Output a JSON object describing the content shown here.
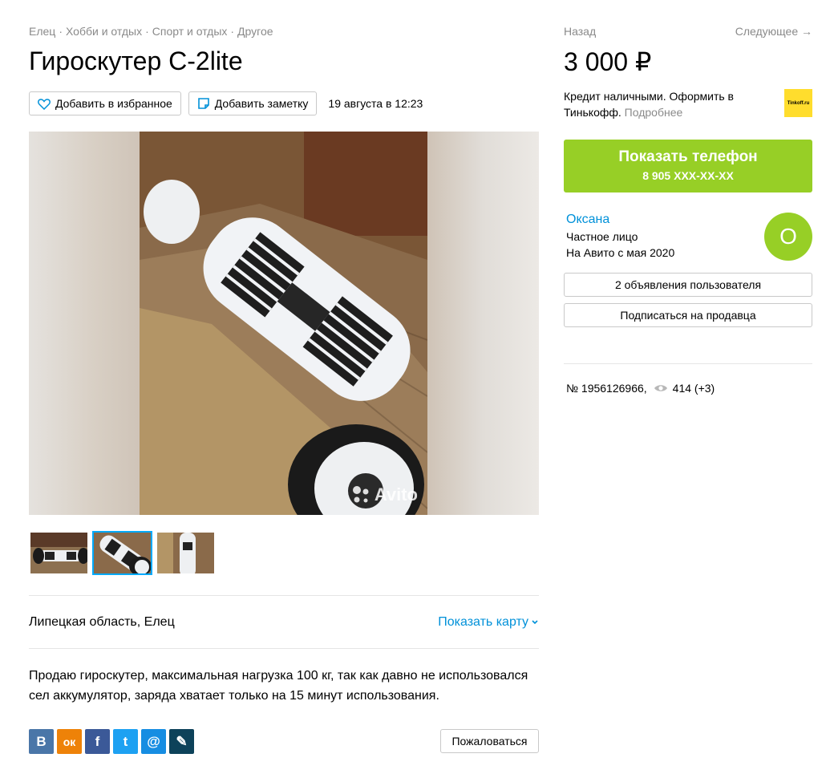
{
  "breadcrumbs": [
    "Елец",
    "Хобби и отдых",
    "Спорт и отдых",
    "Другое"
  ],
  "title": "Гироскутер C-2lite",
  "actions": {
    "favorite_label": "Добавить в избранное",
    "note_label": "Добавить заметку",
    "date": "19 августа в 12:23"
  },
  "gallery": {
    "watermark": "Avito",
    "thumbnails": 3,
    "active_thumbnail": 2
  },
  "location": {
    "text": "Липецкая область, Елец",
    "map_link": "Показать карту"
  },
  "description": "Продаю гироскутер, максимальная нагрузка 100 кг, так как давно не использовался сел аккумулятор, заряда хватает только на 15 минут использования.",
  "social": [
    {
      "name": "vk",
      "glyph": "B",
      "color": "#4a76a8"
    },
    {
      "name": "ok",
      "glyph": "ок",
      "color": "#ee8208"
    },
    {
      "name": "facebook",
      "glyph": "f",
      "color": "#3b5998"
    },
    {
      "name": "twitter",
      "glyph": "t",
      "color": "#1da1f2"
    },
    {
      "name": "mail",
      "glyph": "@",
      "color": "#168de2"
    },
    {
      "name": "livejournal",
      "glyph": "✎",
      "color": "#0d425a"
    }
  ],
  "complain_label": "Пожаловаться",
  "nav": {
    "back": "Назад",
    "next": "Следующее →"
  },
  "price": "3 000 ₽",
  "credit": {
    "text": "Кредит наличными. Оформить в Тинькофф.",
    "more": "Подробнее",
    "logo_text": "Tinkoff.ru"
  },
  "phone_button": {
    "label": "Показать телефон",
    "number": "8 905 XXX-XX-XX"
  },
  "seller": {
    "name": "Оксана",
    "type": "Частное лицо",
    "since": "На Авито с мая 2020",
    "avatar_letter": "О",
    "listings_label": "2 объявления пользователя",
    "subscribe_label": "Подписаться на продавца"
  },
  "meta": {
    "ad_number": "№ 1956126966,",
    "views": "414 (+3)"
  },
  "colors": {
    "accent_green": "#97cf26",
    "link_blue": "#0091d9",
    "active_thumb_border": "#00aaff"
  }
}
